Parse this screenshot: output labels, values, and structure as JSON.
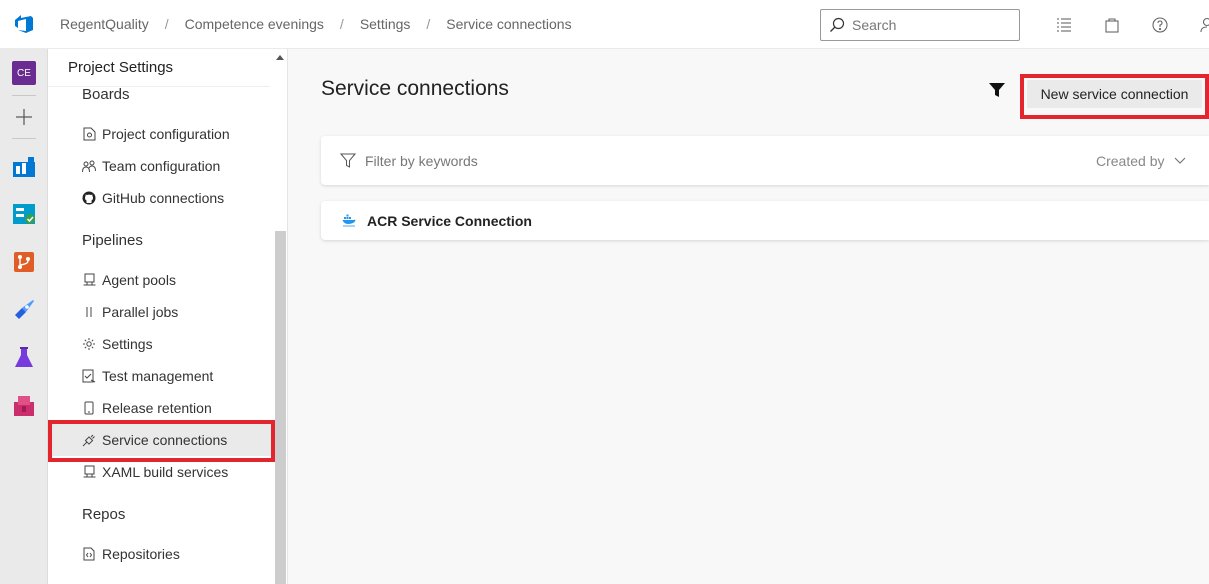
{
  "breadcrumb": {
    "org": "RegentQuality",
    "project": "Competence evenings",
    "settings": "Settings",
    "current": "Service connections"
  },
  "search": {
    "placeholder": "Search"
  },
  "rail": {
    "project_badge": "CE"
  },
  "nav": {
    "title": "Project Settings",
    "sections": {
      "boards": "Boards",
      "pipelines": "Pipelines",
      "repos": "Repos"
    },
    "boards_items": [
      "Project configuration",
      "Team configuration",
      "GitHub connections"
    ],
    "pipelines_items": [
      "Agent pools",
      "Parallel jobs",
      "Settings",
      "Test management",
      "Release retention",
      "Service connections",
      "XAML build services"
    ],
    "repos_items": [
      "Repositories"
    ]
  },
  "main": {
    "title": "Service connections",
    "new_button": "New service connection",
    "filter_placeholder": "Filter by keywords",
    "sort_label": "Created by",
    "connections": [
      "ACR Service Connection"
    ]
  },
  "colors": {
    "accent_blue": "#0078d4",
    "highlight_red": "#e3262e",
    "project_badge": "#6b2c91"
  }
}
